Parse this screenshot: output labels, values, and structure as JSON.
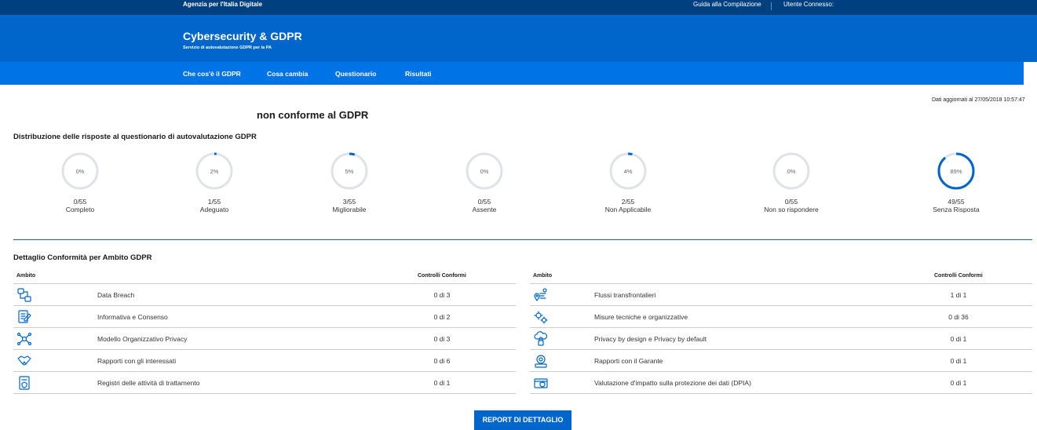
{
  "topbar": {
    "agency": "Agenzia per l'Italia Digitale",
    "guide": "Guida alla Compilazione",
    "user": "Utente Connesso:"
  },
  "header": {
    "title": "Cybersecurity & GDPR",
    "subtitle": "Servizio di autovalutazione GDPR per la PA"
  },
  "nav": [
    "Che cos'è il GDPR",
    "Cosa cambia",
    "Questionario",
    "Risultati"
  ],
  "updated": "Dati aggiornati al 27/05/2018 10:57:47",
  "status": "non conforme al GDPR",
  "distribution": {
    "title": "Distribuzione delle risposte al questionario di autovalutazione GDPR",
    "accent": "#0066cc",
    "track": "#dfe3e8",
    "items": [
      {
        "pct": "0%",
        "value": 0,
        "count": "0/55",
        "label": "Completo"
      },
      {
        "pct": "2%",
        "value": 2,
        "count": "1/55",
        "label": "Adeguato"
      },
      {
        "pct": "5%",
        "value": 5,
        "count": "3/55",
        "label": "Migliorabile"
      },
      {
        "pct": "0%",
        "value": 0,
        "count": "0/55",
        "label": "Assente"
      },
      {
        "pct": "4%",
        "value": 4,
        "count": "2/55",
        "label": "Non Applicabile"
      },
      {
        "pct": "0%",
        "value": 0,
        "count": "0/55",
        "label": "Non so rispondere"
      },
      {
        "pct": "89%",
        "value": 89,
        "count": "49/55",
        "label": "Senza Risposta"
      }
    ]
  },
  "detail": {
    "title": "Dettaglio Conformità per Ambito GDPR",
    "col_ambito": "Ambito",
    "col_controlli": "Controlli Conformi",
    "left": [
      {
        "icon": "data-breach-icon",
        "name": "Data Breach",
        "value": "0 di 3"
      },
      {
        "icon": "informativa-icon",
        "name": "Informativa e Consenso",
        "value": "0 di 2"
      },
      {
        "icon": "network-icon",
        "name": "Modello Organizzativo Privacy",
        "value": "0 di 3"
      },
      {
        "icon": "handshake-icon",
        "name": "Rapporti con gli interessati",
        "value": "0 di 6"
      },
      {
        "icon": "register-icon",
        "name": "Registri delle attività di trattamento",
        "value": "0 di 1"
      }
    ],
    "right": [
      {
        "icon": "location-flow-icon",
        "name": "Flussi transfrontalieri",
        "value": "1 di 1"
      },
      {
        "icon": "gears-icon",
        "name": "Misure tecniche e organizzative",
        "value": "0 di 36"
      },
      {
        "icon": "cloud-lock-icon",
        "name": "Privacy by design e Privacy by default",
        "value": "0 di 1"
      },
      {
        "icon": "authority-icon",
        "name": "Rapporti con il Garante",
        "value": "0 di 1"
      },
      {
        "icon": "shield-card-icon",
        "name": "Valutazione d'impatto sulla protezione dei dati (DPIA)",
        "value": "0 di 1"
      }
    ]
  },
  "button": "REPORT DI DETTAGLIO"
}
